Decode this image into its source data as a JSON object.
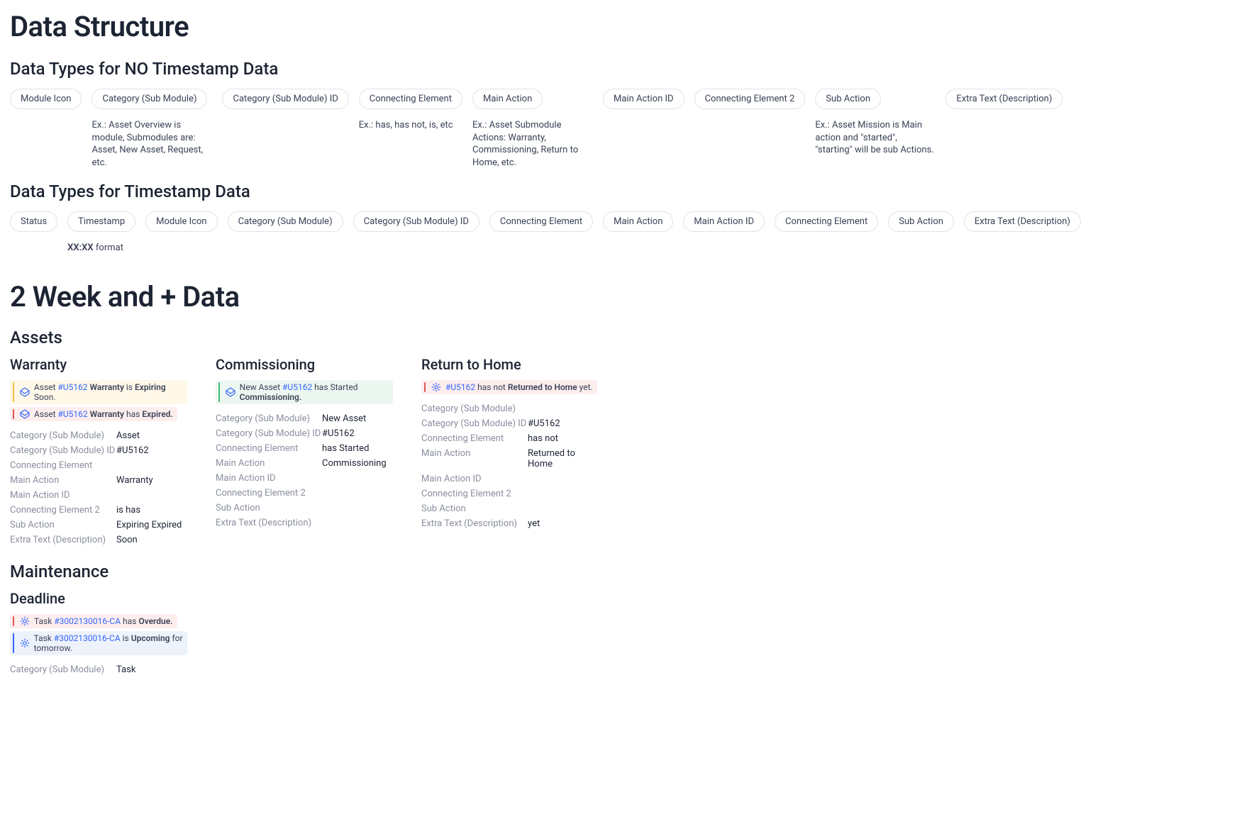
{
  "title": "Data Structure",
  "section1": {
    "heading": "Data Types for NO Timestamp Data",
    "pills": [
      {
        "label": "Module Icon",
        "desc": ""
      },
      {
        "label": "Category (Sub Module)",
        "desc": "Ex.: Asset Overview is module, Submodules are: Asset, New Asset, Request, etc."
      },
      {
        "label": "Category (Sub Module) ID",
        "desc": ""
      },
      {
        "label": "Connecting Element",
        "desc": "Ex.: has, has not, is, etc"
      },
      {
        "label": "Main Action",
        "desc": "Ex.: Asset Submodule Actions: Warranty, Commissioning, Return to Home, etc."
      },
      {
        "label": "Main Action ID",
        "desc": ""
      },
      {
        "label": "Connecting Element 2",
        "desc": ""
      },
      {
        "label": "Sub Action",
        "desc": "Ex.: Asset Mission is Main action and \"started\", \"starting\" will be sub Actions."
      },
      {
        "label": "Extra Text (Description)",
        "desc": ""
      }
    ]
  },
  "section2": {
    "heading": "Data Types for Timestamp Data",
    "pills": [
      {
        "label": "Status",
        "desc": ""
      },
      {
        "label": "Timestamp",
        "desc_bold": "XX:XX",
        "desc_rest": " format"
      },
      {
        "label": "Module Icon",
        "desc": ""
      },
      {
        "label": "Category (Sub Module)",
        "desc": ""
      },
      {
        "label": "Category (Sub Module) ID",
        "desc": ""
      },
      {
        "label": "Connecting Element",
        "desc": ""
      },
      {
        "label": "Main Action",
        "desc": ""
      },
      {
        "label": "Main Action ID",
        "desc": ""
      },
      {
        "label": "Connecting Element",
        "desc": ""
      },
      {
        "label": "Sub Action",
        "desc": ""
      },
      {
        "label": "Extra Text (Description)",
        "desc": ""
      }
    ]
  },
  "big_heading": "2 Week and + Data",
  "assets": {
    "heading": "Assets",
    "columns": [
      {
        "title": "Warranty",
        "logs": [
          {
            "cls": "warn",
            "icon": "asset",
            "parts": [
              "Asset ",
              {
                "id": "#U5162"
              },
              " ",
              {
                "b": "Warranty"
              },
              " is ",
              {
                "b": "Expiring"
              },
              " Soon."
            ]
          },
          {
            "cls": "err",
            "icon": "asset",
            "parts": [
              "Asset ",
              {
                "id": "#U5162"
              },
              " ",
              {
                "b": "Warranty"
              },
              " has ",
              {
                "b": "Expired."
              }
            ]
          }
        ],
        "kv": [
          {
            "k": "Category (Sub Module)",
            "v": "Asset"
          },
          {
            "k": "Category (Sub Module) ID",
            "v": "#U5162"
          },
          {
            "k": "Connecting Element",
            "v": ""
          },
          {
            "k": "Main Action",
            "v": "Warranty"
          },
          {
            "k": "Main Action ID",
            "v": ""
          },
          {
            "k": "Connecting Element 2",
            "v": "is   has"
          },
          {
            "k": "Sub Action",
            "v": "Expiring   Expired"
          },
          {
            "k": "Extra Text (Description)",
            "v": "Soon"
          }
        ]
      },
      {
        "title": "Commissioning",
        "logs": [
          {
            "cls": "ok",
            "icon": "asset",
            "parts": [
              "New Asset ",
              {
                "id": "#U5162"
              },
              " has Started ",
              {
                "b": "Commissioning."
              }
            ]
          }
        ],
        "kv": [
          {
            "k": "Category (Sub Module)",
            "v": "New Asset"
          },
          {
            "k": "Category (Sub Module) ID",
            "v": "#U5162"
          },
          {
            "k": "Connecting Element",
            "v": "has Started"
          },
          {
            "k": "Main Action",
            "v": "Commissioning"
          },
          {
            "k": "Main Action ID",
            "v": ""
          },
          {
            "k": "Connecting Element 2",
            "v": ""
          },
          {
            "k": "Sub Action",
            "v": ""
          },
          {
            "k": "Extra Text (Description)",
            "v": ""
          }
        ]
      },
      {
        "title": "Return to Home",
        "logs": [
          {
            "cls": "err",
            "icon": "gear",
            "parts": [
              {
                "id": "#U5162"
              },
              " has not ",
              {
                "b": "Returned to Home"
              },
              " yet."
            ]
          }
        ],
        "kv": [
          {
            "k": "Category (Sub Module)",
            "v": ""
          },
          {
            "k": "Category (Sub Module) ID",
            "v": "#U5162"
          },
          {
            "k": "Connecting Element",
            "v": "has not"
          },
          {
            "k": "Main Action",
            "v": "Returned to Home"
          },
          {
            "k": "Main Action ID",
            "v": ""
          },
          {
            "k": "Connecting Element 2",
            "v": ""
          },
          {
            "k": "Sub Action",
            "v": ""
          },
          {
            "k": "Extra Text (Description)",
            "v": "yet"
          }
        ]
      }
    ]
  },
  "maintenance": {
    "heading": "Maintenance",
    "columns": [
      {
        "title": "Deadline",
        "logs": [
          {
            "cls": "err",
            "icon": "gear",
            "parts": [
              "Task ",
              {
                "id": "#3002130016-CA"
              },
              " has ",
              {
                "b": "Overdue."
              }
            ]
          },
          {
            "cls": "info",
            "icon": "gear",
            "parts": [
              "Task ",
              {
                "id": "#3002130016-CA"
              },
              " is ",
              {
                "b": "Upcoming"
              },
              " for tomorrow."
            ]
          }
        ],
        "kv": [
          {
            "k": "Category (Sub Module)",
            "v": "Task"
          }
        ]
      }
    ]
  }
}
